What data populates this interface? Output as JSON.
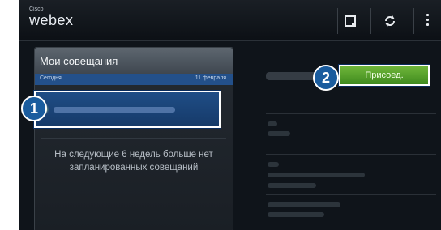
{
  "app": {
    "logo_small": "Cisco",
    "logo_main": "webex"
  },
  "toolbar": {
    "icons": [
      "calendar-icon",
      "refresh-icon",
      "more-vert-icon"
    ]
  },
  "meetings_panel": {
    "title": "Мои совещания",
    "date_left": "Сегодня",
    "date_right": "11 февраля",
    "empty_message": "На следующие 6 недель больше нет запланированных совещаний"
  },
  "detail": {
    "join_label": "Присоед."
  },
  "callouts": {
    "one": "1",
    "two": "2"
  },
  "colors": {
    "background": "#0f141a",
    "accent_blue": "#1a5c9e",
    "join_green": "#5aa32c",
    "highlight": "#ffffff"
  }
}
